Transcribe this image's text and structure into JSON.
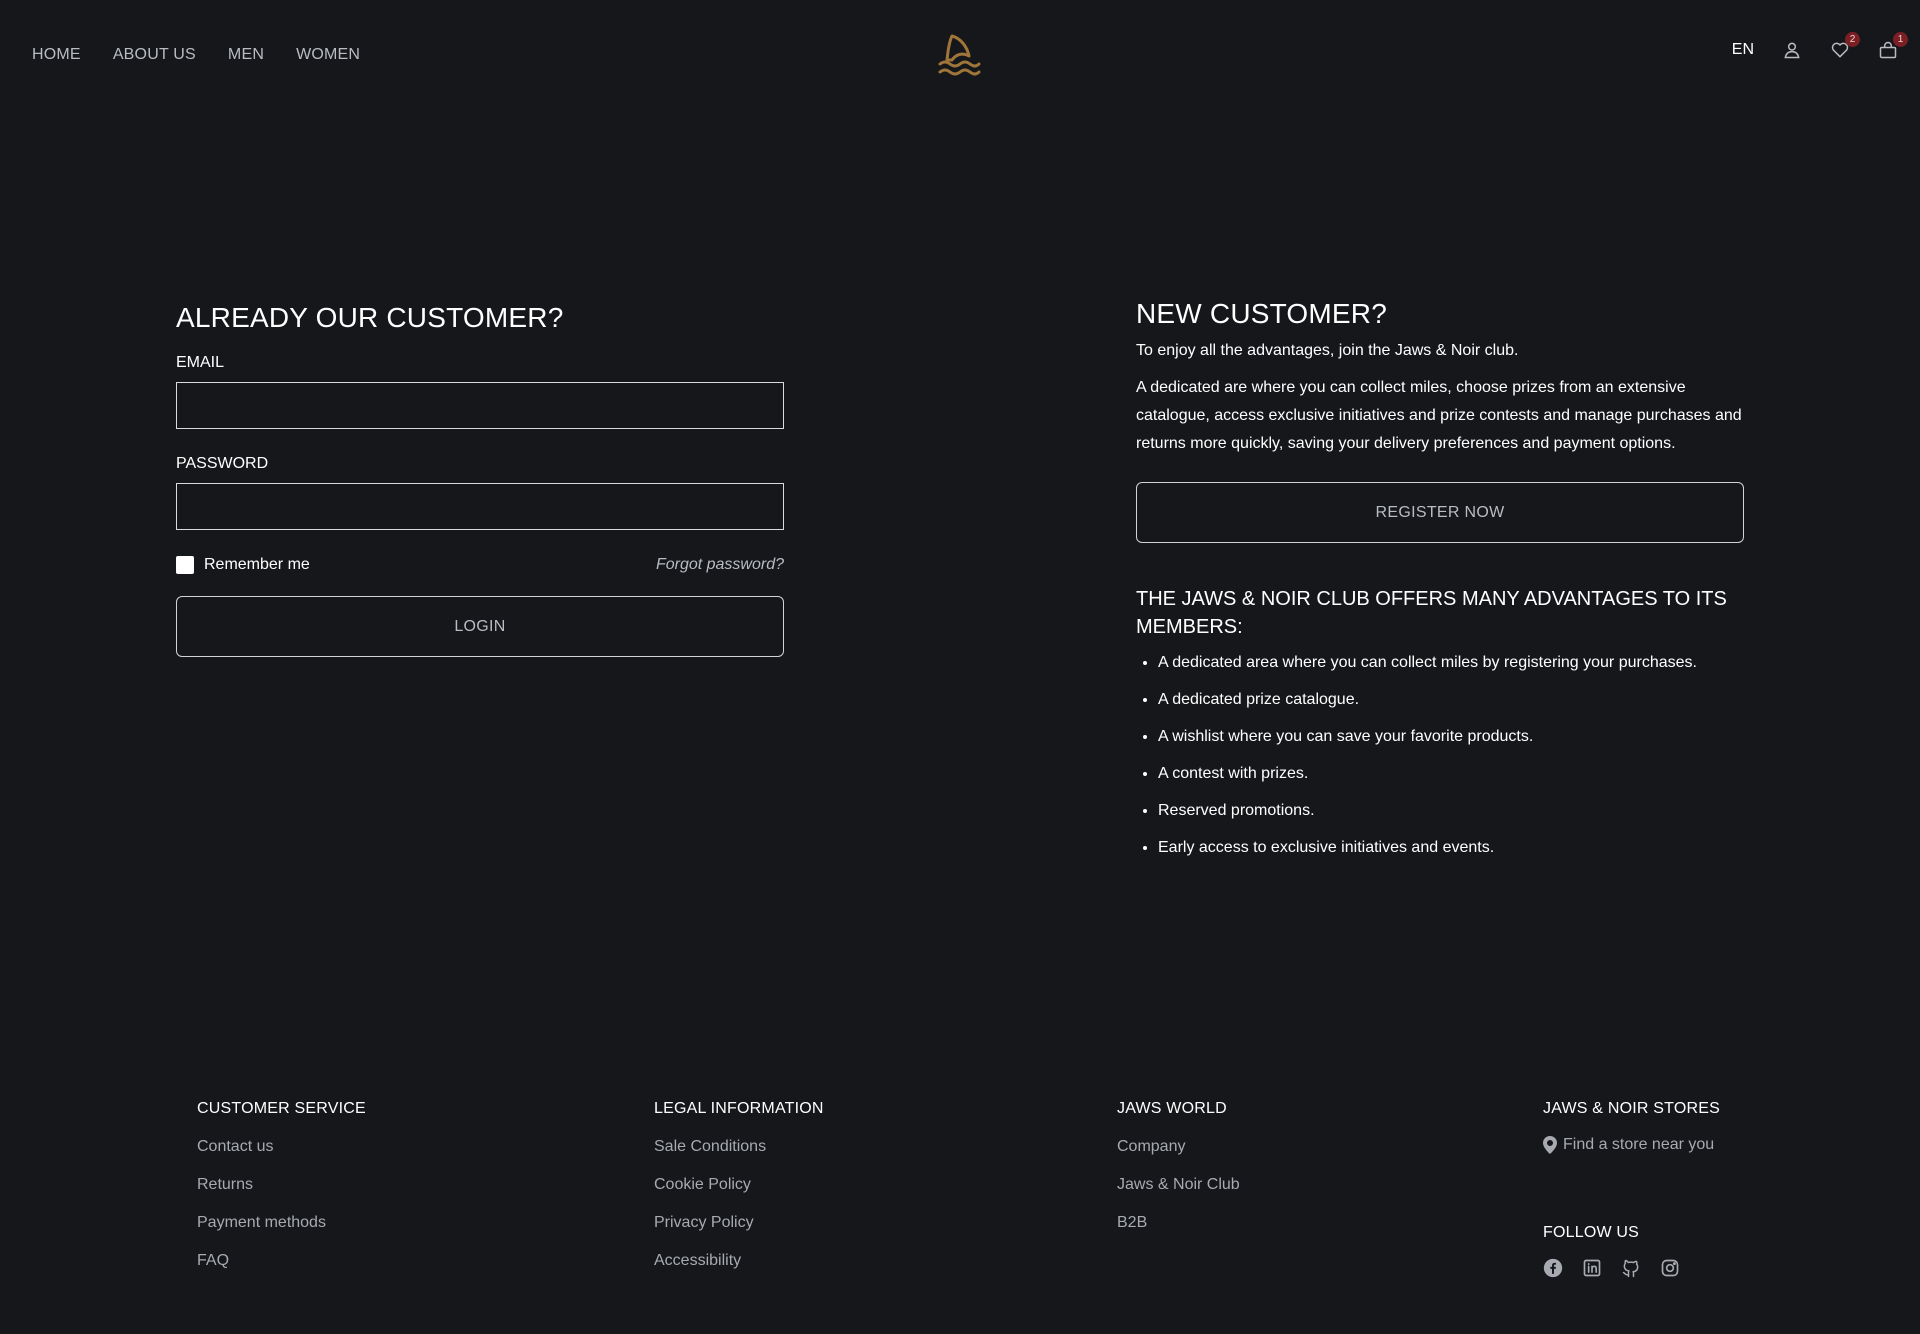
{
  "header": {
    "nav": [
      "HOME",
      "ABOUT US",
      "MEN",
      "WOMEN"
    ],
    "lang": "EN",
    "wishlist_count": "2",
    "cart_count": "1",
    "logo_icon": "shark-fin-waves-icon",
    "logo_color": "#a0753a"
  },
  "login": {
    "title": "ALREADY OUR CUSTOMER?",
    "email_label": "EMAIL",
    "email_value": "",
    "password_label": "PASSWORD",
    "password_value": "",
    "remember_label": "Remember me",
    "forgot_label": "Forgot password?",
    "login_button": "LOGIN"
  },
  "register": {
    "title": "NEW CUSTOMER?",
    "intro": "To enjoy all the advantages, join the Jaws & Noir club.",
    "description": "A dedicated are where you can collect miles, choose prizes from an extensive catalogue, access exclusive initiatives and prize contests and manage purchases and returns more quickly, saving your delivery preferences and payment options.",
    "register_button": "REGISTER NOW",
    "club_title": "THE JAWS & NOIR CLUB OFFERS MANY ADVANTAGES TO ITS MEMBERS:",
    "benefits": [
      "A dedicated area where you can collect miles by registering your purchases.",
      "A dedicated prize catalogue.",
      "A wishlist where you can save your favorite products.",
      "A contest with prizes.",
      "Reserved promotions.",
      "Early access to exclusive initiatives and events."
    ]
  },
  "footer": {
    "customer_service": {
      "title": "CUSTOMER SERVICE",
      "links": [
        "Contact us",
        "Returns",
        "Payment methods",
        "FAQ"
      ]
    },
    "legal": {
      "title": "LEGAL INFORMATION",
      "links": [
        "Sale Conditions",
        "Cookie Policy",
        "Privacy Policy",
        "Accessibility"
      ]
    },
    "world": {
      "title": "JAWS WORLD",
      "links": [
        "Company",
        "Jaws & Noir Club",
        "B2B"
      ]
    },
    "stores": {
      "title": "JAWS & NOIR STORES",
      "find_store": "Find a store near you"
    },
    "follow": {
      "title": "FOLLOW US",
      "icons": [
        "facebook-icon",
        "linkedin-icon",
        "github-icon",
        "instagram-icon"
      ]
    }
  }
}
